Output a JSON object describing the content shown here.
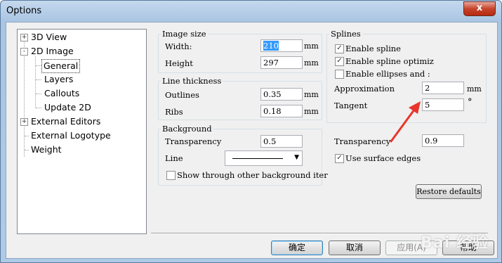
{
  "window": {
    "title": "Options",
    "close_symbol": "x"
  },
  "tree": {
    "items": [
      {
        "label": "3D View",
        "expander": "+"
      },
      {
        "label": "2D Image",
        "expander": "-"
      },
      {
        "label": "General",
        "selected": true
      },
      {
        "label": "Layers"
      },
      {
        "label": "Callouts"
      },
      {
        "label": "Update 2D"
      },
      {
        "label": "External Editors",
        "expander": "+"
      },
      {
        "label": "External Logotype"
      },
      {
        "label": "Weight"
      }
    ]
  },
  "image_size": {
    "caption": "Image size",
    "width_label": "Width:",
    "width_value": "210",
    "height_label": "Height",
    "height_value": "297",
    "unit": "mm"
  },
  "line_thickness": {
    "caption": "Line thickness",
    "outlines_label": "Outlines",
    "outlines_value": "0.35",
    "ribs_label": "Ribs",
    "ribs_value": "0.18",
    "unit": "mm"
  },
  "background": {
    "caption": "Background",
    "transparency_label": "Transparency",
    "transparency_value": "0.5",
    "line_label": "Line",
    "show_through_label": "Show through other background iter"
  },
  "splines": {
    "caption": "Splines",
    "enable_spline": "Enable spline",
    "enable_optimize": "Enable spline optimiz",
    "enable_ellipses": "Enable ellipses and :",
    "approximation_label": "Approximation",
    "approximation_value": "2",
    "approximation_unit": "mm",
    "tangent_label": "Tangent",
    "tangent_value": "5",
    "tangent_unit": "°"
  },
  "right": {
    "transparency_label": "Transparency",
    "transparency_value": "0.9",
    "use_surface_edges": "Use surface edges",
    "restore_defaults": "Restore defaults"
  },
  "buttons": {
    "ok": "确定",
    "cancel": "取消",
    "apply": "应用(A)",
    "help": "帮助"
  },
  "watermark": "Bai 经验",
  "colors": {
    "annotation_arrow": "#e8352a",
    "selection": "#3399ff"
  }
}
